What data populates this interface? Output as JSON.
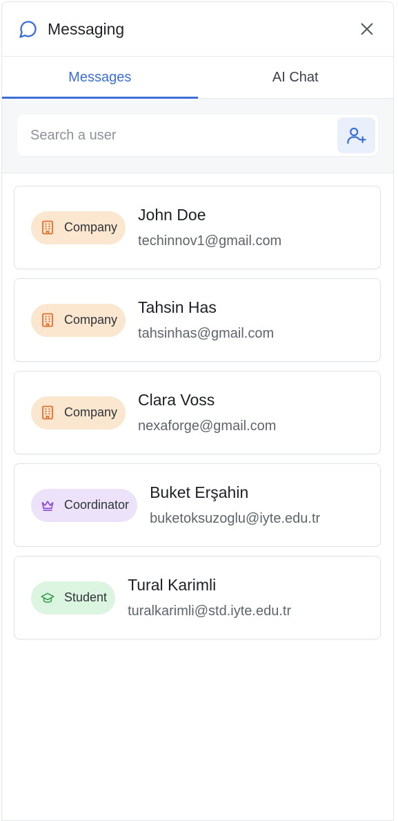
{
  "header": {
    "title": "Messaging"
  },
  "tabs": [
    {
      "label": "Messages",
      "active": true
    },
    {
      "label": "AI Chat",
      "active": false
    }
  ],
  "search": {
    "placeholder": "Search a user",
    "value": ""
  },
  "contacts": [
    {
      "role": "Company",
      "role_icon": "building-icon",
      "name": "John Doe",
      "email": "techinnov1@gmail.com"
    },
    {
      "role": "Company",
      "role_icon": "building-icon",
      "name": "Tahsin Has",
      "email": "tahsinhas@gmail.com"
    },
    {
      "role": "Company",
      "role_icon": "building-icon",
      "name": "Clara Voss",
      "email": "nexaforge@gmail.com"
    },
    {
      "role": "Coordinator",
      "role_icon": "crown-icon",
      "name": "Buket Erşahin",
      "email": "buketoksuzoglu@iyte.edu.tr"
    },
    {
      "role": "Student",
      "role_icon": "graduation-cap-icon",
      "name": "Tural Karimli",
      "email": "turalkarimli@std.iyte.edu.tr"
    }
  ],
  "colors": {
    "accent": "#3a6fd8",
    "company_badge": "#fbe7d0",
    "coordinator_badge": "#ece3fa",
    "student_badge": "#dcf5e0"
  }
}
